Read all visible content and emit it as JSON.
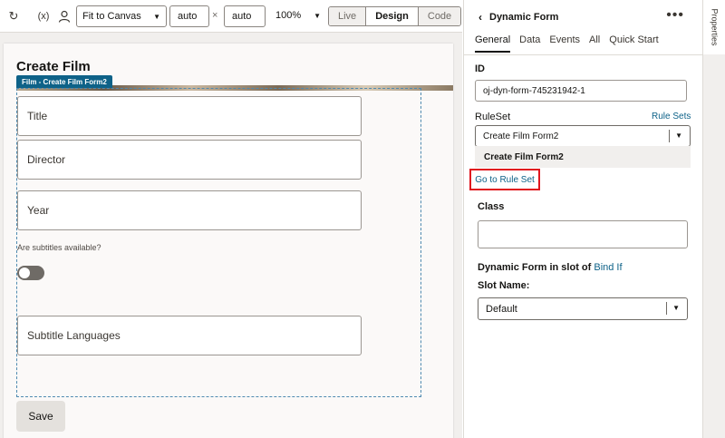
{
  "toolbar": {
    "refresh_icon": "refresh-icon",
    "variables_label": "(x)",
    "user_icon": "user-icon",
    "fit_select": "Fit to Canvas",
    "width_value": "auto",
    "height_value": "auto",
    "times": "×",
    "zoom": "100%",
    "modes": [
      "Live",
      "Design",
      "Code"
    ],
    "active_mode": "Design"
  },
  "canvas": {
    "page_title": "Create Film",
    "form_tag": "Film - Create Film Form2",
    "fields": {
      "title": "Title",
      "director": "Director",
      "year": "Year",
      "subtitles_question": "Are subtitles available?",
      "subtitle_languages": "Subtitle Languages"
    },
    "save_button": "Save"
  },
  "properties": {
    "header": "Dynamic Form",
    "more": "•••",
    "tabs": [
      "General",
      "Data",
      "Events",
      "All",
      "Quick Start"
    ],
    "id_label": "ID",
    "id_value": "oj-dyn-form-745231942-1",
    "ruleset_label": "RuleSet",
    "rule_sets_link": "Rule Sets",
    "ruleset_value": "Create Film Form2",
    "dropdown_option": "Create Film Form2",
    "go_to_rule_set": "Go to Rule Set",
    "class_label": "Class",
    "class_value": "",
    "slot_text": "Dynamic Form in slot of",
    "bind_if": "Bind If",
    "slot_name_label": "Slot Name:",
    "slot_name_value": "Default"
  },
  "side_tab": "Properties",
  "colors": {
    "accent": "#0e6288",
    "highlight": "#e0161e"
  }
}
